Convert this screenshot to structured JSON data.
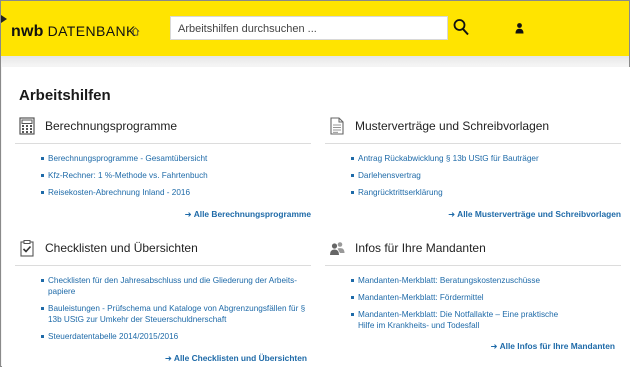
{
  "header": {
    "logo_brand": "nwb",
    "logo_product": "DATENBANK",
    "search_placeholder": "Arbeitshilfen durchsuchen ..."
  },
  "page": {
    "title": "Arbeitshilfen"
  },
  "sections": [
    {
      "title": "Berechnungsprogramme",
      "icon": "calculator-icon",
      "items": [
        "Berechnungsprogramme - Gesamtübersicht",
        "Kfz-Rechner: 1 %-Methode vs. Fahrtenbuch",
        "Reisekosten-Abrechnung Inland - 2016"
      ],
      "more": "Alle Berechnungsprogramme"
    },
    {
      "title": "Musterverträge und Schreibvorlagen",
      "icon": "document-icon",
      "items": [
        "Antrag Rückabwicklung § 13b UStG für Bauträger",
        "Darlehensvertrag",
        "Rangrücktrittserklärung"
      ],
      "more": "Alle Musterverträge und Schreibvorlagen"
    },
    {
      "title": "Checklisten und Übersichten",
      "icon": "checklist-icon",
      "items": [
        "Checklisten für den Jahresabschluss und die Gliederung der Arbeits-papiere",
        "Bauleistungen - Prüfschema und Kataloge von Abgrenzungsfällen für § 13b UStG zur Umkehr der Steuerschuldnerschaft",
        "Steuerdatentabelle 2014/2015/2016"
      ],
      "more": "Alle Checklisten und Übersichten"
    },
    {
      "title": "Infos für Ihre Mandanten",
      "icon": "users-icon",
      "items": [
        "Mandanten-Merkblatt: Beratungskostenzuschüsse",
        "Mandanten-Merkblatt: Fördermittel",
        "Mandanten-Merkblatt: Die Notfallakte – Eine praktische Hilfe im Krankheits- und Todesfall"
      ],
      "more": "Alle Infos für Ihre Mandanten"
    }
  ],
  "colors": {
    "header_yellow": "#ffe400",
    "link_blue": "#1e6aa8"
  }
}
